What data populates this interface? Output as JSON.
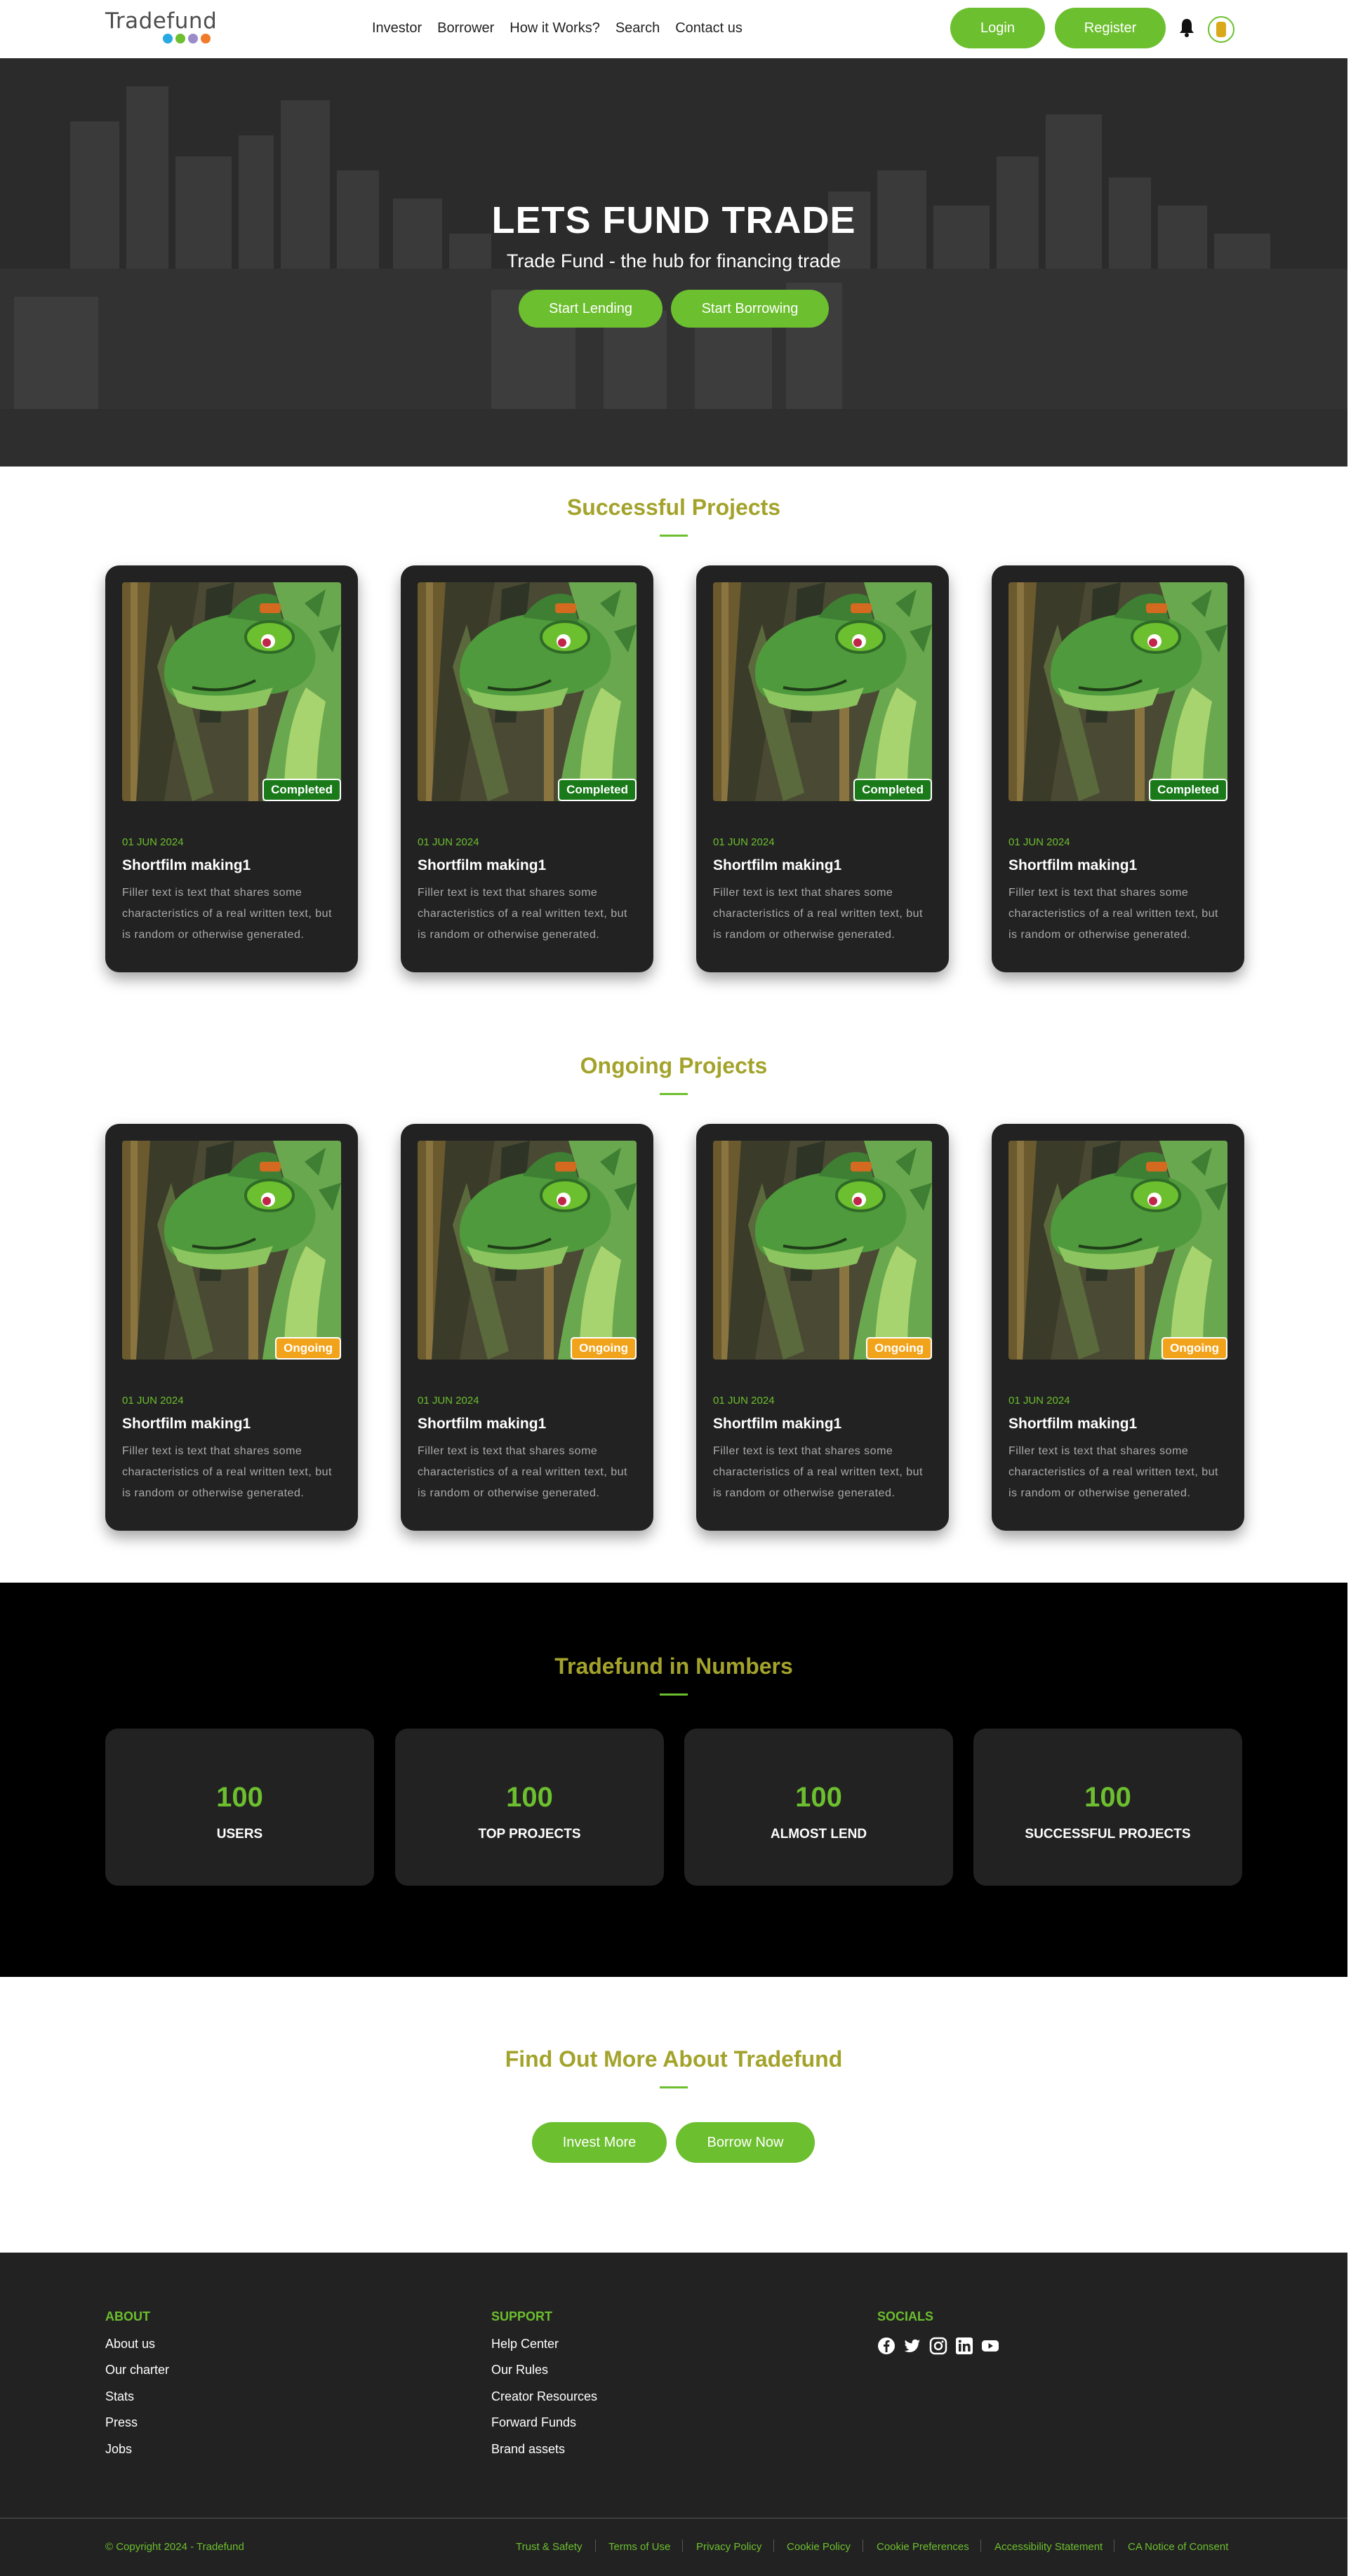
{
  "header": {
    "logo_text": "Tradefund",
    "nav": [
      "Investor",
      "Borrower",
      "How it Works?",
      "Search",
      "Contact us"
    ],
    "login_label": "Login",
    "register_label": "Register"
  },
  "hero": {
    "title": "LETS FUND TRADE",
    "subtitle": "Trade Fund - the hub for financing trade",
    "lend_label": "Start Lending",
    "borrow_label": "Start Borrowing"
  },
  "successful": {
    "title": "Successful Projects",
    "cards": [
      {
        "badge": "Completed",
        "date": "01 JUN 2024",
        "title": "Shortfilm making1",
        "text": "Filler text is text that shares some characteristics of a real written text, but is random or otherwise generated."
      },
      {
        "badge": "Completed",
        "date": "01 JUN 2024",
        "title": "Shortfilm making1",
        "text": "Filler text is text that shares some characteristics of a real written text, but is random or otherwise generated."
      },
      {
        "badge": "Completed",
        "date": "01 JUN 2024",
        "title": "Shortfilm making1",
        "text": "Filler text is text that shares some characteristics of a real written text, but is random or otherwise generated."
      },
      {
        "badge": "Completed",
        "date": "01 JUN 2024",
        "title": "Shortfilm making1",
        "text": "Filler text is text that shares some characteristics of a real written text, but is random or otherwise generated."
      }
    ]
  },
  "ongoing": {
    "title": "Ongoing Projects",
    "cards": [
      {
        "badge": "Ongoing",
        "date": "01 JUN 2024",
        "title": "Shortfilm making1",
        "text": "Filler text is text that shares some characteristics of a real written text, but is random or otherwise generated."
      },
      {
        "badge": "Ongoing",
        "date": "01 JUN 2024",
        "title": "Shortfilm making1",
        "text": "Filler text is text that shares some characteristics of a real written text, but is random or otherwise generated."
      },
      {
        "badge": "Ongoing",
        "date": "01 JUN 2024",
        "title": "Shortfilm making1",
        "text": "Filler text is text that shares some characteristics of a real written text, but is random or otherwise generated."
      },
      {
        "badge": "Ongoing",
        "date": "01 JUN 2024",
        "title": "Shortfilm making1",
        "text": "Filler text is text that shares some characteristics of a real written text, but is random or otherwise generated."
      }
    ]
  },
  "numbers": {
    "title": "Tradefund in Numbers",
    "stats": [
      {
        "value": "100",
        "label": "USERS"
      },
      {
        "value": "100",
        "label": "TOP PROJECTS"
      },
      {
        "value": "100",
        "label": "ALMOST LEND"
      },
      {
        "value": "100",
        "label": "SUCCESSFUL PROJECTS"
      }
    ]
  },
  "find_more": {
    "title": "Find Out More About Tradefund",
    "invest_label": "Invest More",
    "borrow_label": "Borrow Now"
  },
  "footer": {
    "about_heading": "ABOUT",
    "about_links": [
      "About us",
      "Our charter",
      "Stats",
      "Press",
      "Jobs"
    ],
    "support_heading": "SUPPORT",
    "support_links": [
      "Help Center",
      "Our Rules",
      "Creator Resources",
      "Forward Funds",
      "Brand assets"
    ],
    "socials_heading": "SOCIALS",
    "socials": [
      "facebook-icon",
      "twitter-icon",
      "instagram-icon",
      "linkedin-icon",
      "youtube-icon"
    ],
    "copyright": "© Copyright 2024 - Tradefund",
    "legal_links": [
      "Trust & Safety",
      "Terms of Use",
      "Privacy Policy",
      "Cookie Policy",
      "Cookie Preferences",
      "Accessibility Statement",
      "CA Notice of Consent"
    ]
  },
  "colors": {
    "accent_green": "#6cbf2e",
    "title_olive": "#a3a32c",
    "completed_badge": "#1a7a1a",
    "ongoing_badge": "#f2a31c",
    "card_bg": "#222222"
  }
}
